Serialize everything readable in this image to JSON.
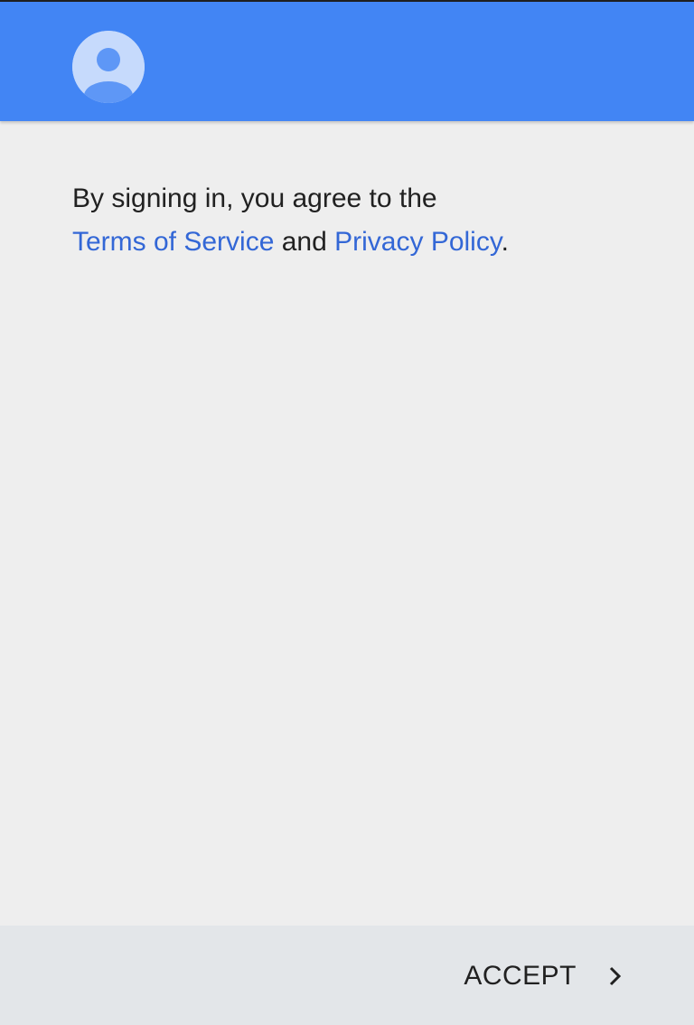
{
  "header": {
    "avatar_icon": "account-circle-icon",
    "background_color": "#4285f4"
  },
  "consent": {
    "intro_text": "By signing in, you agree to the",
    "terms_link": "Terms of Service",
    "conjunction": "and",
    "privacy_link": "Privacy Policy",
    "period": "."
  },
  "footer": {
    "accept_label": "ACCEPT",
    "accept_icon": "chevron-right-icon"
  },
  "colors": {
    "link": "#3367d6",
    "text": "#212121",
    "footer_bg": "#e3e6e9"
  }
}
